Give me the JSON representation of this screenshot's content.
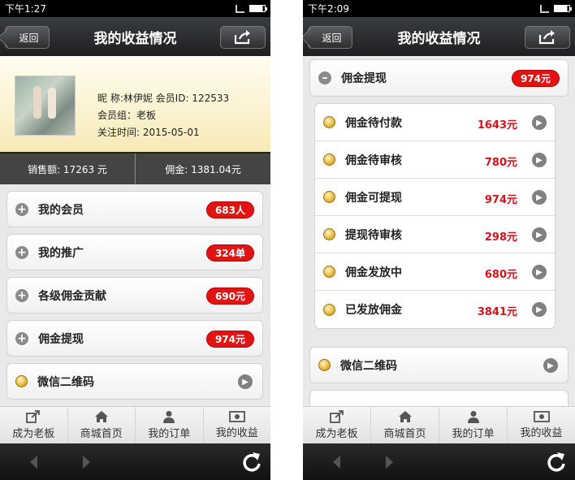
{
  "left": {
    "status": {
      "time": "下午1:27"
    },
    "nav": {
      "back": "返回",
      "title": "我的收益情况"
    },
    "profile": {
      "line1": "昵 称:林伊妮 会员ID: 122533",
      "line2": "会员组：老板",
      "line3": "关注时间: 2015-05-01"
    },
    "stats": {
      "sales": "销售额: 17263 元",
      "commission": "佣金: 1381.04元"
    },
    "rows": [
      {
        "label": "我的会员",
        "badge": "683人"
      },
      {
        "label": "我的推广",
        "badge": "324单"
      },
      {
        "label": "各级佣金贡献",
        "badge": "690元"
      },
      {
        "label": "佣金提现",
        "badge": "974元"
      },
      {
        "label": "微信二维码"
      }
    ],
    "tabs": [
      "成为老板",
      "商城首页",
      "我的订单",
      "我的收益"
    ]
  },
  "right": {
    "status": {
      "time": "下午2:09"
    },
    "nav": {
      "back": "返回",
      "title": "我的收益情况"
    },
    "header": {
      "label": "佣金提现",
      "badge": "974元"
    },
    "items": [
      {
        "label": "佣金待付款",
        "amount": "1643元"
      },
      {
        "label": "佣金待审核",
        "amount": "780元"
      },
      {
        "label": "佣金可提现",
        "amount": "974元"
      },
      {
        "label": "提现待审核",
        "amount": "298元"
      },
      {
        "label": "佣金发放中",
        "amount": "680元"
      },
      {
        "label": "已发放佣金",
        "amount": "3841元"
      }
    ],
    "wx": {
      "label": "微信二维码"
    },
    "tabs": [
      "成为老板",
      "商城首页",
      "我的订单",
      "我的收益"
    ]
  },
  "icons": {
    "share": "share-icon",
    "tab_icons": [
      "external-link-icon",
      "home-icon",
      "user-icon",
      "money-icon"
    ],
    "system": [
      "back-arrow-icon",
      "forward-arrow-icon",
      "refresh-icon"
    ]
  },
  "colors": {
    "badge_red": "#e21313",
    "amount_red": "#d4141a",
    "navbar_dark": "#1d1f21"
  }
}
